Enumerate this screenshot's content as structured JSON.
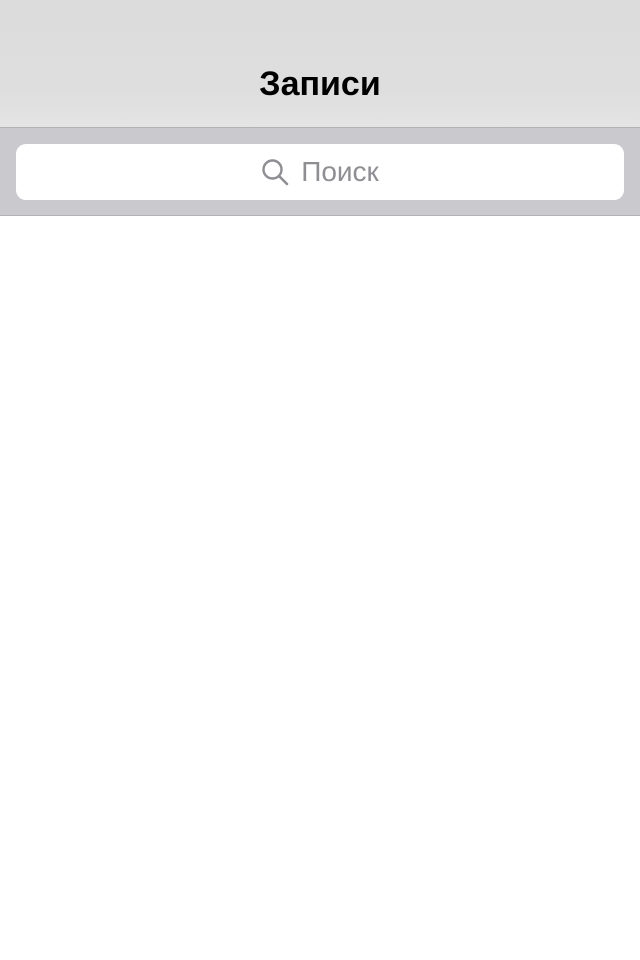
{
  "nav": {
    "title": "Записи"
  },
  "search": {
    "placeholder": "Поиск",
    "icon": "search-icon"
  },
  "colors": {
    "nav_background": "#dedede",
    "search_bar_background": "#c9c9ce",
    "placeholder_text": "#8e8e93"
  }
}
